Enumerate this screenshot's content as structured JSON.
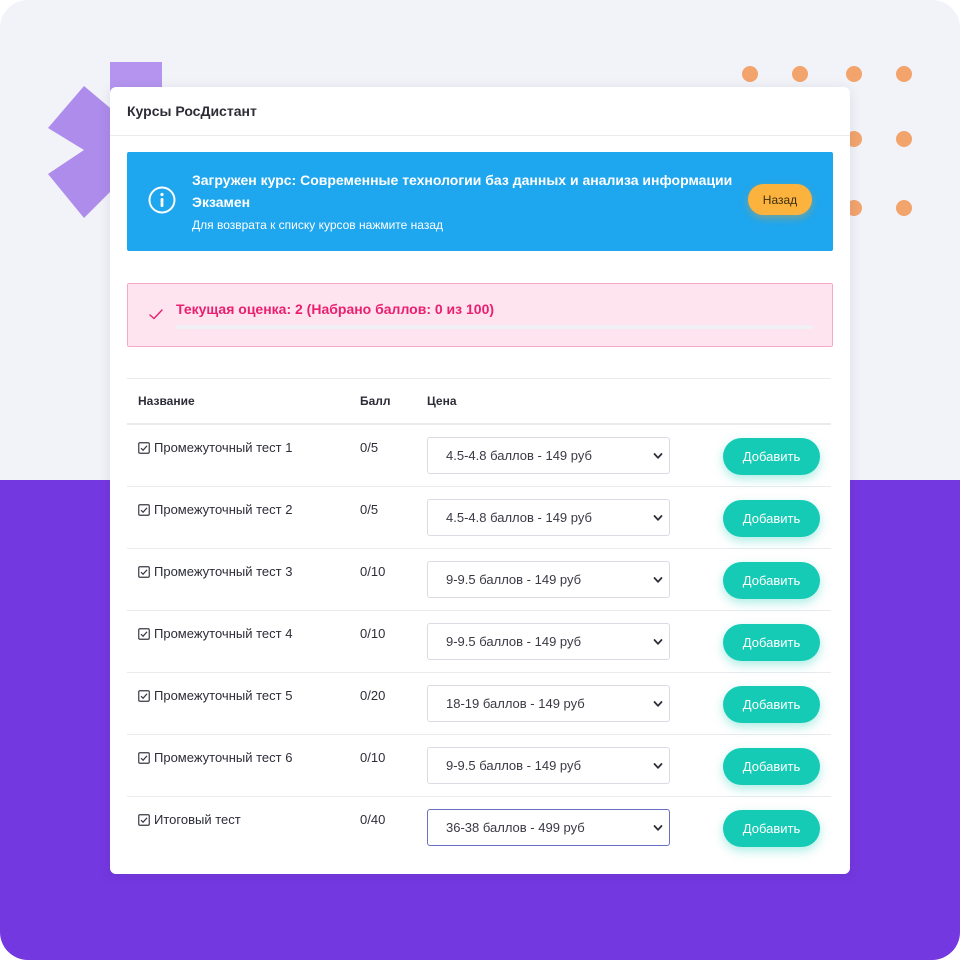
{
  "colors": {
    "background": "#f1f3f8",
    "purple": "#7438e0",
    "info_alert": "#1ea6ee",
    "grade_alert_bg": "#fde4ef",
    "grade_text": "#ea1f6f",
    "accent_button": "#16cbb5",
    "back_button": "#fbb33e",
    "decor_dots": "#f2a46c"
  },
  "card": {
    "title": "Курсы РосДистант"
  },
  "info_alert": {
    "icon": "info-icon",
    "title": "Загружен курс: Современные технологии баз данных и анализа информации Экзамен",
    "subtitle": "Для возврата к списку курсов нажмите назад",
    "back_label": "Назад"
  },
  "grade": {
    "icon": "check-icon",
    "text": "Текущая оценка: 2 (Набрано баллов: 0 из 100)",
    "progress_fraction": 0
  },
  "table": {
    "columns": {
      "name": "Название",
      "score": "Балл",
      "price": "Цена"
    },
    "rows": [
      {
        "name": "Промежуточный тест 1",
        "score": "0/5",
        "price": "4.5-4.8 баллов - 149 руб",
        "action": "Добавить"
      },
      {
        "name": "Промежуточный тест 2",
        "score": "0/5",
        "price": "4.5-4.8 баллов - 149 руб",
        "action": "Добавить"
      },
      {
        "name": "Промежуточный тест 3",
        "score": "0/10",
        "price": "9-9.5 баллов - 149 руб",
        "action": "Добавить"
      },
      {
        "name": "Промежуточный тест 4",
        "score": "0/10",
        "price": "9-9.5 баллов - 149 руб",
        "action": "Добавить"
      },
      {
        "name": "Промежуточный тест 5",
        "score": "0/20",
        "price": "18-19 баллов - 149 руб",
        "action": "Добавить"
      },
      {
        "name": "Промежуточный тест 6",
        "score": "0/10",
        "price": "9-9.5 баллов - 149 руб",
        "action": "Добавить"
      },
      {
        "name": "Итоговый тест",
        "score": "0/40",
        "price": "36-38 баллов - 499 руб",
        "action": "Добавить"
      }
    ]
  }
}
